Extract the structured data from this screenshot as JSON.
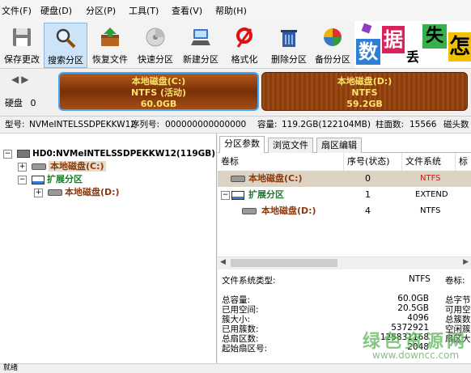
{
  "menu": [
    "文件(F)",
    "硬盘(D)",
    "分区(P)",
    "工具(T)",
    "查看(V)",
    "帮助(H)"
  ],
  "toolbar": [
    {
      "label": "保存更改",
      "icon": "save-icon"
    },
    {
      "label": "搜索分区",
      "icon": "magnifier-icon"
    },
    {
      "label": "恢复文件",
      "icon": "restore-box-icon"
    },
    {
      "label": "快速分区",
      "icon": "quick-partition-icon"
    },
    {
      "label": "新建分区",
      "icon": "new-partition-icon"
    },
    {
      "label": "格式化",
      "icon": "format-icon"
    },
    {
      "label": "删除分区",
      "icon": "trash-icon"
    },
    {
      "label": "备份分区",
      "icon": "backup-pie-icon"
    }
  ],
  "banner": {
    "chars": [
      "数",
      "据",
      "丢",
      "失",
      "怎"
    ]
  },
  "diskbar": {
    "disk_label": "硬盘",
    "disk_index": "0",
    "partitions": [
      {
        "name": "本地磁盘(C:)",
        "fs": "NTFS (活动)",
        "size": "60.0GB"
      },
      {
        "name": "本地磁盘(D:)",
        "fs": "NTFS",
        "size": "59.2GB"
      }
    ]
  },
  "info": {
    "model_label": "型号:",
    "model": "NVMeINTELSSDPEKKW12",
    "serial_label": "序列号:",
    "serial": "000000000000000",
    "capacity_label": "容量:",
    "capacity": "119.2GB(122104MB)",
    "cyl_label": "柱面数:",
    "cyl": "15566",
    "heads_label": "磁头数"
  },
  "tree": {
    "disk": "HD0:NVMeINTELSSDPEKKW12(119GB)",
    "c": "本地磁盘(C:)",
    "ext": "扩展分区",
    "d": "本地磁盘(D:)"
  },
  "tabs": [
    "分区参数",
    "浏览文件",
    "扇区编辑"
  ],
  "table": {
    "headers": [
      "卷标",
      "序号(状态)",
      "文件系统",
      "标"
    ],
    "rows": [
      {
        "label": "本地磁盘(C:)",
        "index": "0",
        "fs": "NTFS"
      },
      {
        "label": "扩展分区",
        "index": "1",
        "fs": "EXTEND"
      },
      {
        "label": "本地磁盘(D:)",
        "index": "4",
        "fs": "NTFS"
      }
    ]
  },
  "fsinfo": {
    "type_label": "文件系统类型:",
    "type": "NTFS",
    "vol_label": "卷标:",
    "left_labels": [
      "总容量:",
      "已用空间:",
      "簇大小:",
      "已用簇数:",
      "总扇区数:",
      "起始扇区号:"
    ],
    "left_values": [
      "60.0GB",
      "20.5GB",
      "4096",
      "5372921",
      "125831168",
      "2048"
    ],
    "right_labels": [
      "总字节",
      "可用空",
      "总簇数",
      "空闲簇",
      "扇区大"
    ]
  },
  "watermark": {
    "brand": "绿色资源网",
    "url": "www.downcc.com"
  },
  "status": {
    "text": "就绪"
  },
  "colors": {
    "partition_brown": "#8b3a0e",
    "partition_gold": "#ffe26b",
    "selection": "#d8c9b0"
  }
}
